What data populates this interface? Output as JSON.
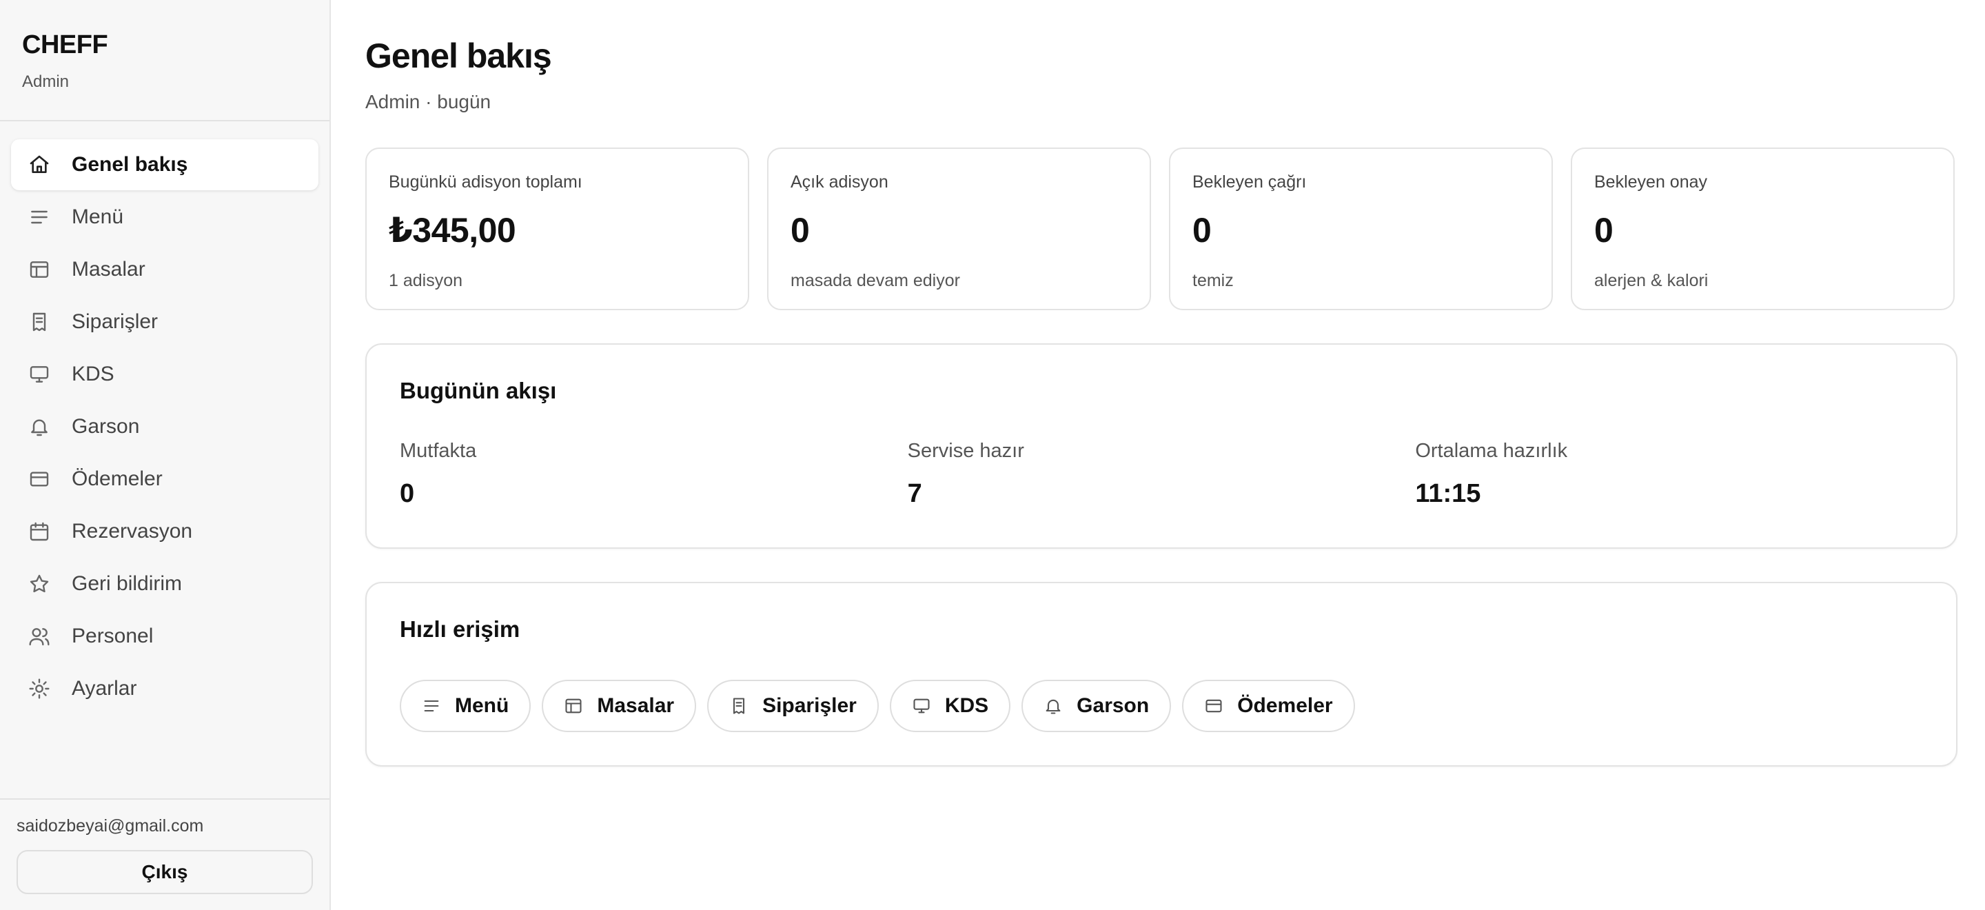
{
  "sidebar": {
    "brand": "CHEFF",
    "role": "Admin",
    "items": [
      {
        "label": "Genel bakış",
        "icon": "home-icon"
      },
      {
        "label": "Menü",
        "icon": "menu-lines-icon"
      },
      {
        "label": "Masalar",
        "icon": "table-layout-icon"
      },
      {
        "label": "Siparişler",
        "icon": "receipt-icon"
      },
      {
        "label": "KDS",
        "icon": "monitor-icon"
      },
      {
        "label": "Garson",
        "icon": "bell-icon"
      },
      {
        "label": "Ödemeler",
        "icon": "credit-card-icon"
      },
      {
        "label": "Rezervasyon",
        "icon": "calendar-icon"
      },
      {
        "label": "Geri bildirim",
        "icon": "star-icon"
      },
      {
        "label": "Personel",
        "icon": "users-icon"
      },
      {
        "label": "Ayarlar",
        "icon": "gear-icon"
      }
    ],
    "user_email": "saidozbeyai@gmail.com",
    "logout_label": "Çıkış"
  },
  "header": {
    "title": "Genel bakış",
    "subtitle": "Admin · bugün"
  },
  "stats": [
    {
      "label": "Bugünkü adisyon toplamı",
      "value": "₺345,00",
      "note": "1 adisyon"
    },
    {
      "label": "Açık adisyon",
      "value": "0",
      "note": "masada devam ediyor"
    },
    {
      "label": "Bekleyen çağrı",
      "value": "0",
      "note": "temiz"
    },
    {
      "label": "Bekleyen onay",
      "value": "0",
      "note": "alerjen & kalori"
    }
  ],
  "flow": {
    "title": "Bugünün akışı",
    "items": [
      {
        "label": "Mutfakta",
        "value": "0"
      },
      {
        "label": "Servise hazır",
        "value": "7"
      },
      {
        "label": "Ortalama hazırlık",
        "value": "11:15"
      }
    ]
  },
  "quick": {
    "title": "Hızlı erişim",
    "items": [
      {
        "label": "Menü",
        "icon": "menu-lines-icon"
      },
      {
        "label": "Masalar",
        "icon": "table-layout-icon"
      },
      {
        "label": "Siparişler",
        "icon": "receipt-icon"
      },
      {
        "label": "KDS",
        "icon": "monitor-icon"
      },
      {
        "label": "Garson",
        "icon": "bell-icon"
      },
      {
        "label": "Ödemeler",
        "icon": "credit-card-icon"
      }
    ]
  }
}
